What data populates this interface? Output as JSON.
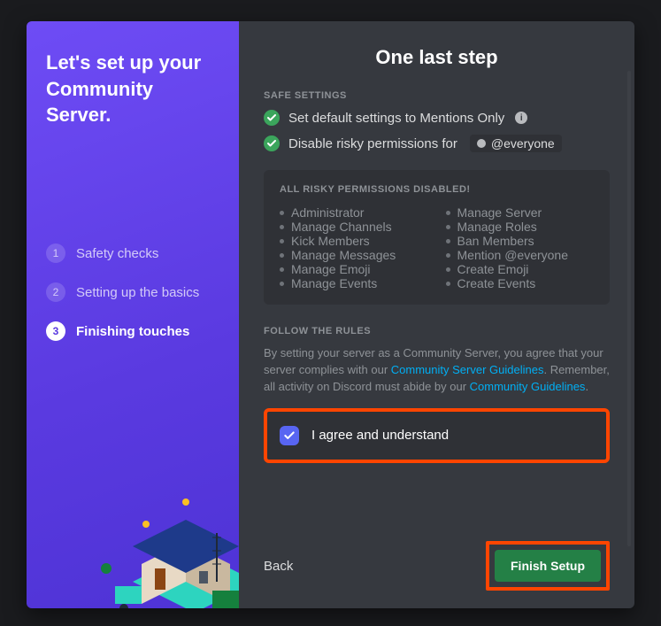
{
  "sidebar": {
    "title": "Let's set up your Community Server.",
    "steps": [
      {
        "num": "1",
        "label": "Safety checks"
      },
      {
        "num": "2",
        "label": "Setting up the basics"
      },
      {
        "num": "3",
        "label": "Finishing touches"
      }
    ]
  },
  "main": {
    "title": "One last step",
    "safe_settings_label": "SAFE SETTINGS",
    "setting1": "Set default settings to Mentions Only",
    "setting2": "Disable risky permissions for",
    "everyone_tag": "@everyone",
    "permissions_header": "ALL RISKY PERMISSIONS DISABLED!",
    "permissions_left": [
      "Administrator",
      "Manage Channels",
      "Kick Members",
      "Manage Messages",
      "Manage Emoji",
      "Manage Events"
    ],
    "permissions_right": [
      "Manage Server",
      "Manage Roles",
      "Ban Members",
      "Mention @everyone",
      "Create Emoji",
      "Create Events"
    ],
    "rules_label": "FOLLOW THE RULES",
    "rules_text1": "By setting your server as a Community Server, you agree that your server complies with our ",
    "rules_link1": "Community Server Guidelines",
    "rules_text2": ". Remember, all activity on Discord must abide by our ",
    "rules_link2": "Community Guidelines",
    "rules_text3": ".",
    "agree_label": "I agree and understand",
    "back_label": "Back",
    "finish_label": "Finish Setup"
  }
}
